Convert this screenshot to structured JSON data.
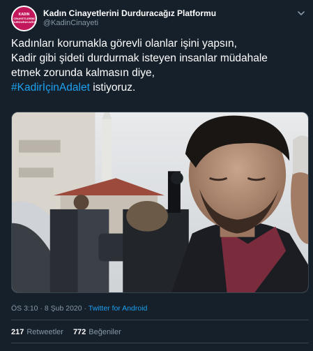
{
  "account": {
    "name": "Kadın Cinayetlerini Durduracağız Platformu",
    "handle": "@KadinCinayeti",
    "avatar_text": [
      "KADIN",
      "CİNAYETLERİNİ",
      "DURDURACAĞIZ"
    ]
  },
  "tweet": {
    "line1": "Kadınları korumakla görevli olanlar işini yapsın,",
    "line2": "Kadir gibi şideti durdurmak isteyen insanlar müdahale",
    "line3": "etmek zorunda kalmasın diye,",
    "hashtag": "#KadirİçinAdalet",
    "line4_rest": "istiyoruz."
  },
  "meta": {
    "time": "ÖS 3:10",
    "separator": "·",
    "date": "8 Şub 2020",
    "app": "Twitter for Android"
  },
  "stats": {
    "retweets_count": "217",
    "retweets_label": "Retweetler",
    "likes_count": "772",
    "likes_label": "Beğeniler"
  },
  "colors": {
    "background": "#15202b",
    "link": "#1da1f2",
    "secondary_text": "#8899a6",
    "divider": "#38444d"
  },
  "icons": {
    "menu": "chevron-down-icon"
  }
}
